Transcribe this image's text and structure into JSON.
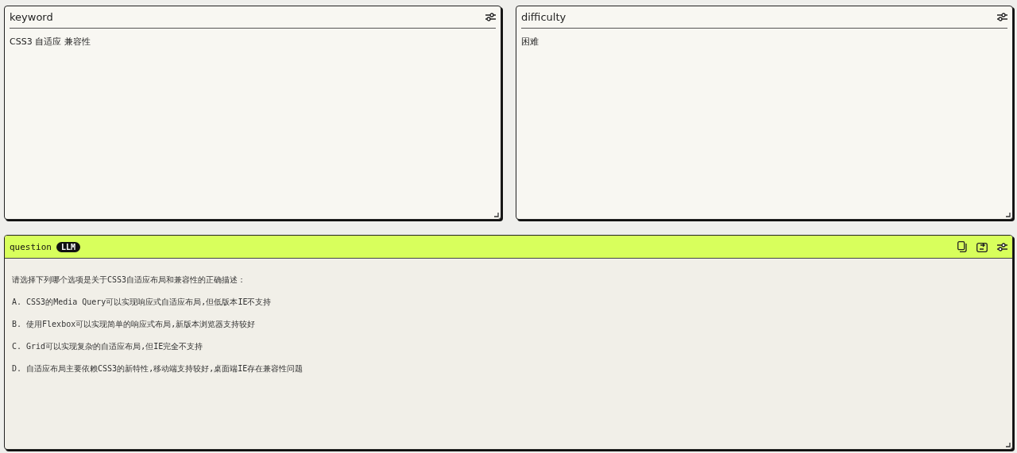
{
  "panels": [
    {
      "title": "keyword",
      "value": "CSS3 自适应 兼容性"
    },
    {
      "title": "difficulty",
      "value": "困难"
    }
  ],
  "question": {
    "title": "question",
    "badge": "LLM",
    "lines": [
      "请选择下列哪个选项是关于CSS3自适应布局和兼容性的正确描述：",
      "A. CSS3的Media Query可以实现响应式自适应布局,但低版本IE不支持",
      "B. 使用Flexbox可以实现简单的响应式布局,新版本浏览器支持较好",
      "C. Grid可以实现复杂的自适应布局,但IE完全不支持",
      "D. 自适应布局主要依赖CSS3的新特性,移动端支持较好,桌面端IE存在兼容性问题"
    ]
  }
}
